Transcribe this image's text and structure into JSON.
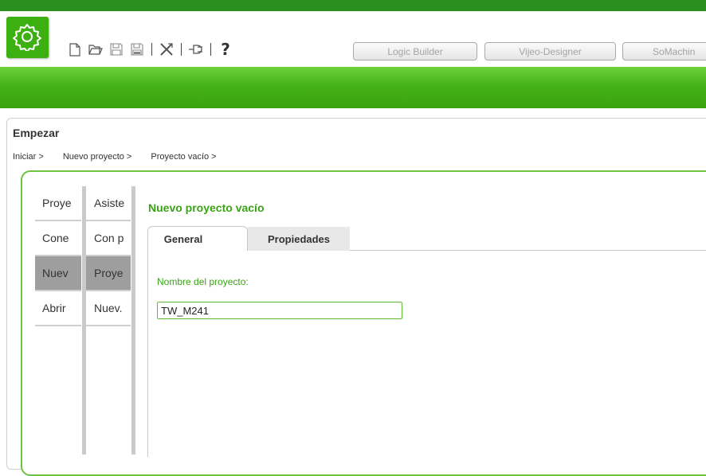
{
  "toolbar": {
    "buttons": {
      "logic_builder": "Logic Builder",
      "vijeo_designer": "Vijeo-Designer",
      "somachine": "SoMachin"
    },
    "help": "?"
  },
  "colors": {
    "brand_green": "#3db011",
    "accent_green": "#3aa216"
  },
  "page": {
    "title": "Empezar",
    "breadcrumb": [
      "Iniciar >",
      "Nuevo proyecto >",
      "Proyecto vacío >"
    ]
  },
  "nav": {
    "column1": [
      "Proye",
      "Cone",
      "Nuev",
      "Abrir"
    ],
    "column2": [
      "Asiste",
      "Con p",
      "Proye",
      "Nuev."
    ]
  },
  "main": {
    "title": "Nuevo proyecto vacío",
    "tabs": [
      "General",
      "Propiedades"
    ],
    "field_label": "Nombre del proyecto:",
    "field_value": "TW_M241"
  }
}
